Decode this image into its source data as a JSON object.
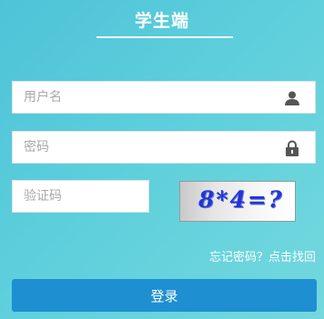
{
  "header": {
    "title": "学生端"
  },
  "form": {
    "username_placeholder": "用户名",
    "password_placeholder": "密码",
    "captcha_placeholder": "验证码",
    "captcha_text": "8*4=?",
    "forgot_link": "忘记密码？点击找回",
    "login_button": "登录"
  },
  "icons": {
    "username": "user-icon",
    "password": "lock-icon"
  },
  "colors": {
    "background": "#5dcfdc",
    "button": "#1e8fd1",
    "captcha_text": "#2037d6"
  }
}
